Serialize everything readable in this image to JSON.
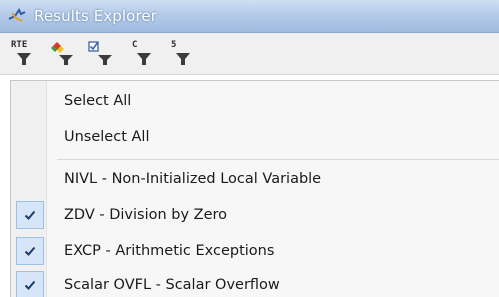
{
  "window": {
    "title": "Results Explorer",
    "title_icon": "results-explorer-icon"
  },
  "toolbar": {
    "buttons": [
      {
        "label": "RTE",
        "icon": "filter-icon"
      },
      {
        "label": "",
        "icon": "color-filter-icon"
      },
      {
        "label": "",
        "icon": "checkbox-filter-icon"
      },
      {
        "label": "C",
        "icon": "filter-icon"
      },
      {
        "label": "5",
        "icon": "filter-icon"
      }
    ]
  },
  "menu": {
    "items": [
      {
        "label": "Select All",
        "checked": false
      },
      {
        "label": "Unselect All",
        "checked": false
      },
      {
        "label": "NIVL - Non-Initialized Local Variable",
        "checked": false
      },
      {
        "label": "ZDV - Division by Zero",
        "checked": true
      },
      {
        "label": "EXCP - Arithmetic Exceptions",
        "checked": true
      },
      {
        "label": "Scalar OVFL - Scalar Overflow",
        "checked": true
      }
    ]
  }
}
